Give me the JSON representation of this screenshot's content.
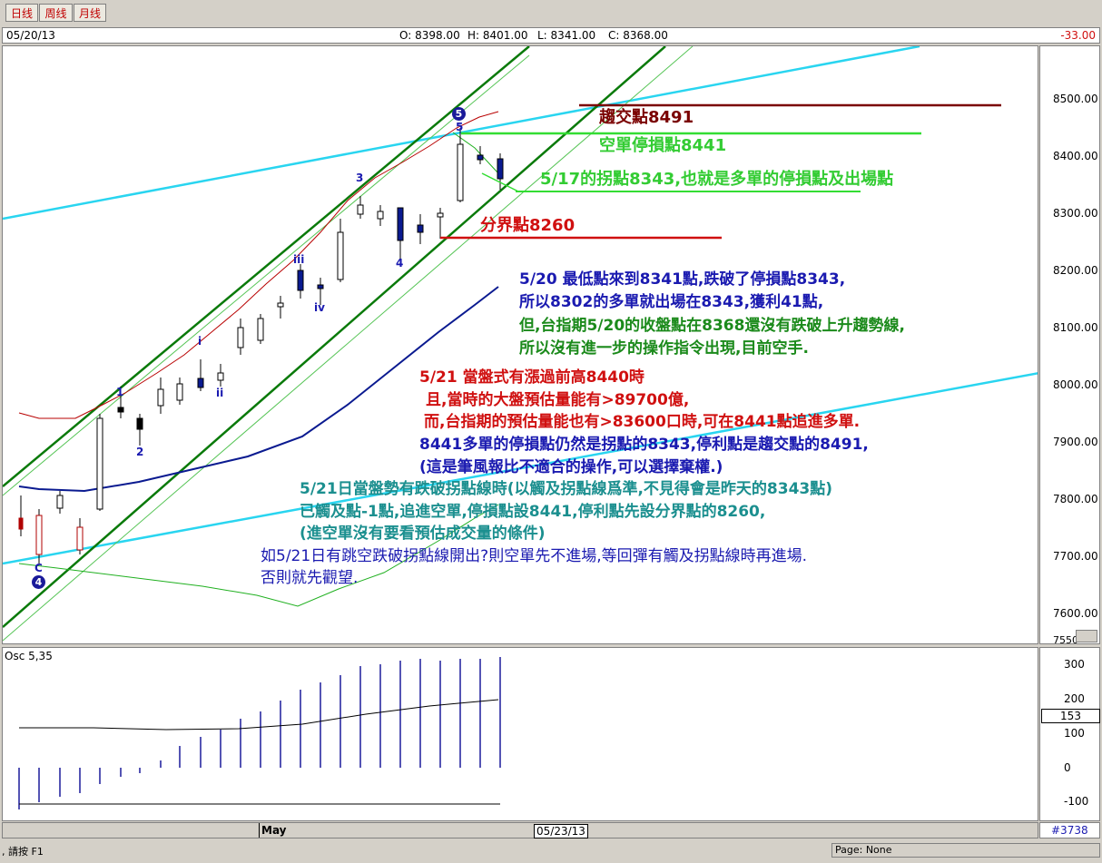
{
  "toolbar": {
    "tabs": [
      "日线",
      "周线",
      "月线"
    ]
  },
  "info": {
    "date": "05/20/13",
    "open": "O: 8398.00",
    "high": "H: 8401.00",
    "low": "L: 8341.00",
    "close": "C: 8368.00",
    "change": "-33.00"
  },
  "price_axis": {
    "ticks": [
      "8500.00",
      "8400.00",
      "8300.00",
      "8200.00",
      "8100.00",
      "8000.00",
      "7900.00",
      "7800.00",
      "7700.00",
      "7600.00",
      "7550"
    ]
  },
  "osc": {
    "title": "Osc 5,35",
    "ticks": [
      "300",
      "200",
      "100",
      "0",
      "-100"
    ],
    "current": "153"
  },
  "date_axis": {
    "month": "May",
    "cursor_date": "05/23/13",
    "bar_count": "#3738"
  },
  "status": {
    "left": ", 請按 F1",
    "page": "Page: None"
  },
  "waves": {
    "w5": "5",
    "w5_circle": "5",
    "w3": "3",
    "w4": "4",
    "w_iii": "iii",
    "w_iv": "iv",
    "w_i": "i",
    "w_ii": "ii",
    "w1": "1",
    "w2": "2",
    "wC": "C",
    "w4_circle": "4"
  },
  "levels": {
    "l8491": "趨交點8491",
    "l8441": "空單停損點8441",
    "l8343": "5/17的拐點8343,也就是多單的停損點及出場點",
    "l8260": "分界點8260"
  },
  "notes": {
    "n1": "5/20 最低點來到8341點,跌破了停損點8343,",
    "n2": "所以8302的多單就出場在8343,獲利41點,",
    "n3": "但,台指期5/20的收盤點在8368還沒有跌破上升趨勢線,",
    "n4": "所以沒有進一步的操作指令出現,目前空手.",
    "r1": "5/21 當盤式有漲過前高8440時",
    "r2": "且,當時的大盤預估量能有>89700億,",
    "r3": "而,台指期的預估量能也有>83600口時,可在8441點追進多單.",
    "b1": "8441多單的停損點仍然是拐點的8343,停利點是趨交點的8491,",
    "b2": "(這是筆風報比不適合的操作,可以選擇棄權.)",
    "t1": "5/21日當盤勢有跌破拐點線時(以觸及拐點線爲準,不見得會是昨天的8343點)",
    "t2": "已觸及點-1點,追進空單,停損點設8441,停利點先設分界點的8260,",
    "t3": "(進空單沒有要看預估成交量的條件)",
    "k1": "如5/21日有跳空跌破拐點線開出?則空單先不進場,等回彈有觸及拐點線時再進場.",
    "k2": "否則就先觀望."
  },
  "colors": {
    "channel": "#0a7a0a",
    "channel_thin": "#55c455",
    "cyan_trend": "#29d5f0",
    "ma_blue": "#0a1a90",
    "ma_red": "#b80000",
    "text_blue": "#1a1ab0",
    "text_green": "#1b8a1b",
    "text_red": "#d01010",
    "text_teal": "#1b8f8f",
    "dark_red": "#7a0000"
  }
}
